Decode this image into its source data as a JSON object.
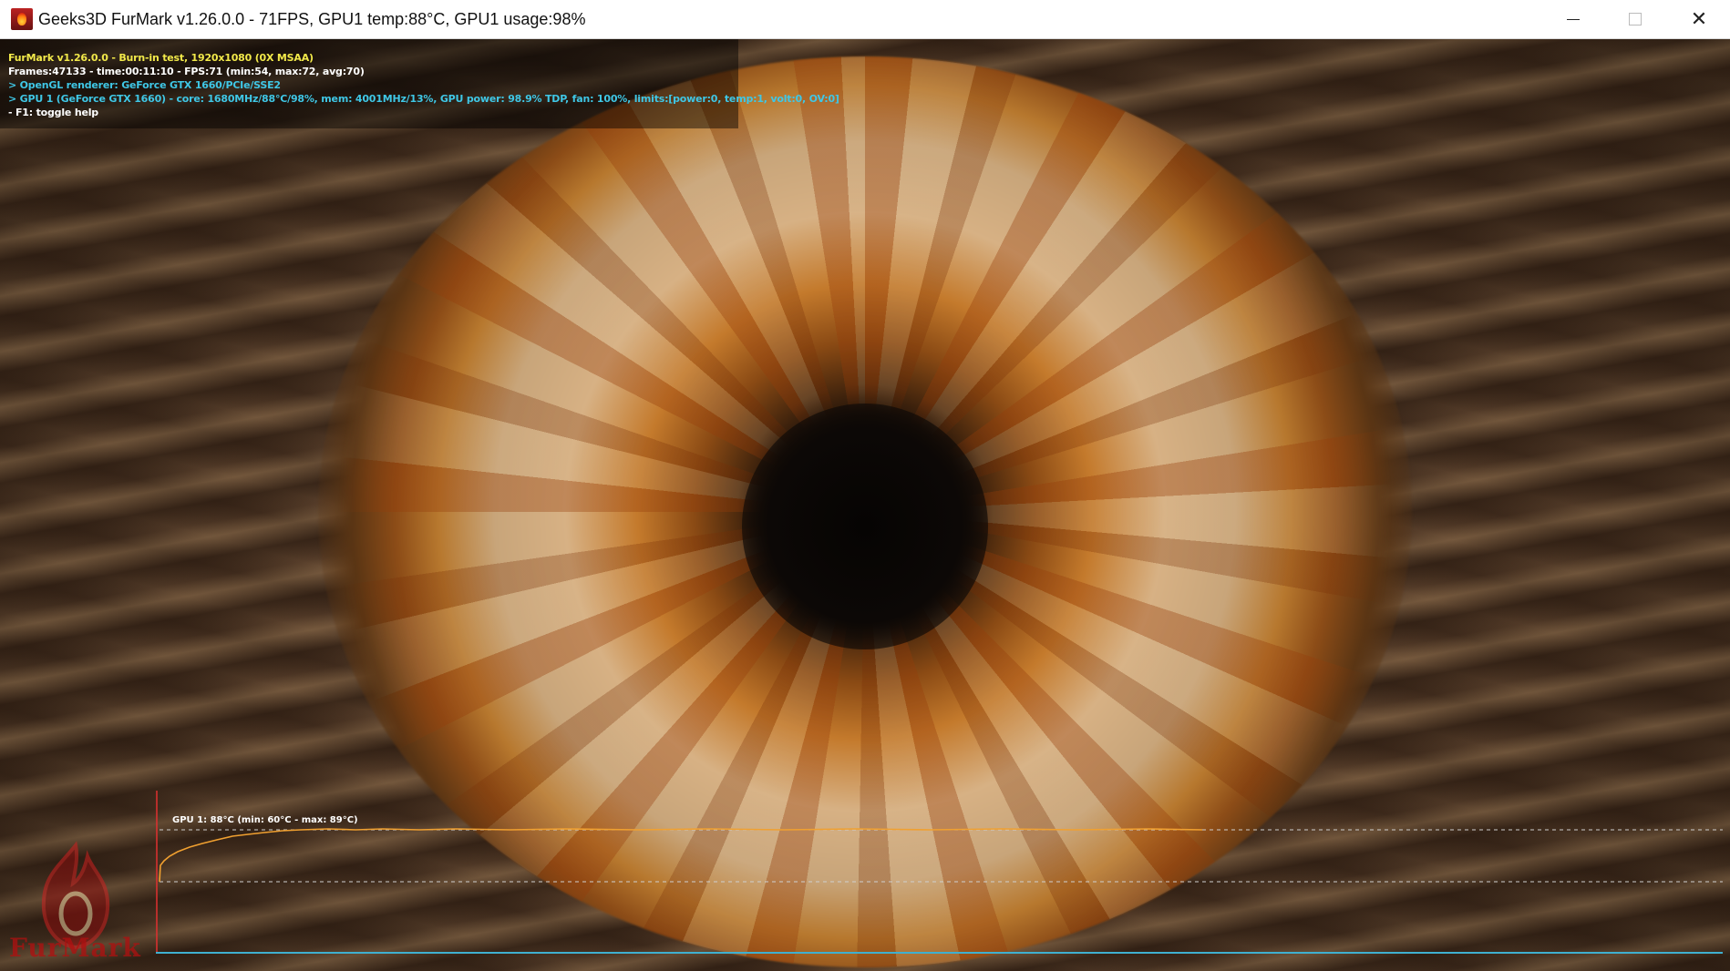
{
  "window": {
    "title": "Geeks3D FurMark v1.26.0.0 - 71FPS, GPU1 temp:88°C, GPU1 usage:98%",
    "icon": "furmark-flame-icon",
    "controls": {
      "minimize_icon": "minimize-icon",
      "maximize_icon": "maximize-icon",
      "close_icon": "close-icon",
      "close_glyph": "✕"
    }
  },
  "osd": {
    "lines": [
      {
        "text": "FurMark v1.26.0.0 - Burn-in test, 1920x1080 (0X MSAA)",
        "color": "#f2e94a"
      },
      {
        "text": "Frames:47133 - time:00:11:10 - FPS:71 (min:54, max:72, avg:70)",
        "color": "#ffffff"
      },
      {
        "text": "> OpenGL renderer: GeForce GTX 1660/PCIe/SSE2",
        "color": "#3fc7e6"
      },
      {
        "text": "> GPU 1 (GeForce GTX 1660) - core: 1680MHz/88°C/98%, mem: 4001MHz/13%, GPU power: 98.9% TDP, fan: 100%, limits:[power:0, temp:1, volt:0, OV:0]",
        "color": "#3fc7e6"
      },
      {
        "text": "- F1: toggle help",
        "color": "#ffffff"
      }
    ]
  },
  "temp_graph": {
    "label": "GPU 1: 88°C (min: 60°C - max: 89°C)",
    "label_color": "#ffffff",
    "line_color": "#f0a030",
    "axis_color": "#3fb0d0",
    "marker_color": "#e03030",
    "guide_color": "#cfcfcf",
    "current": 88,
    "min": 60,
    "max": 89
  },
  "logo": {
    "text": "FurMark",
    "color": "#b01010"
  }
}
